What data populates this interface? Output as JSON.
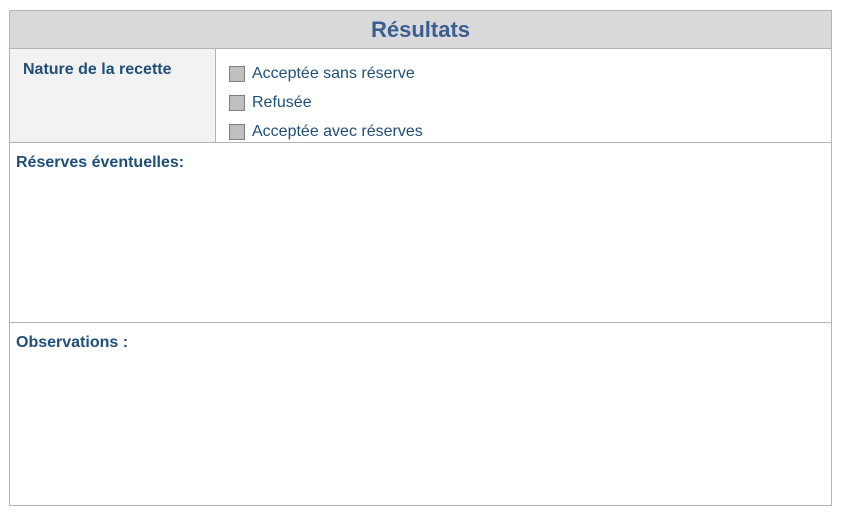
{
  "header": {
    "title": "Résultats"
  },
  "nature": {
    "label": "Nature de la recette",
    "options": [
      {
        "label": "Acceptée sans réserve",
        "checked": false
      },
      {
        "label": "Refusée",
        "checked": false
      },
      {
        "label": "Acceptée avec réserves",
        "checked": false
      }
    ]
  },
  "reserves": {
    "label": "Réserves éventuelles:"
  },
  "observations": {
    "label": "Observations :"
  },
  "colors": {
    "header_bg": "#d9d9d9",
    "title_text": "#3a5e91",
    "label_text": "#1f4e79",
    "checkbox_fill": "#bfbfbf"
  }
}
